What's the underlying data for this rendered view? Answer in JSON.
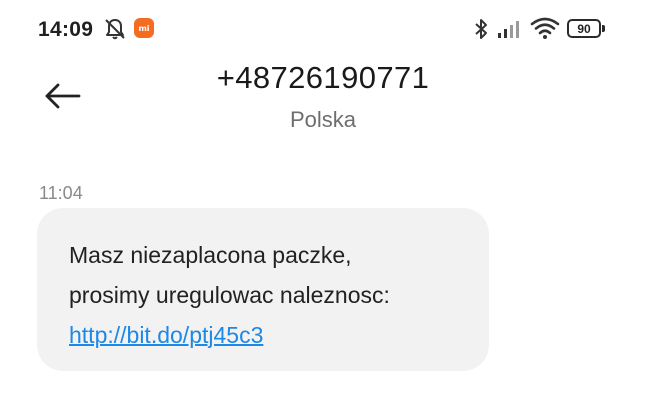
{
  "status_bar": {
    "time": "14:09",
    "battery": "90",
    "icons": [
      "notifications-off-icon",
      "mi-app-icon",
      "bluetooth-icon",
      "signal-icon",
      "wifi-icon",
      "battery-icon"
    ],
    "mi_label": "mi"
  },
  "header": {
    "contact_number": "+48726190771",
    "contact_country": "Polska"
  },
  "conversation": {
    "messages": [
      {
        "time": "11:04",
        "lines": [
          "Masz niezaplacona paczke,",
          "prosimy uregulowac naleznosc:"
        ],
        "link": "http://bit.do/ptj45c3"
      }
    ]
  },
  "colors": {
    "accent": "#f36c21",
    "link": "#1e88e5",
    "bubble": "#f2f2f2"
  }
}
